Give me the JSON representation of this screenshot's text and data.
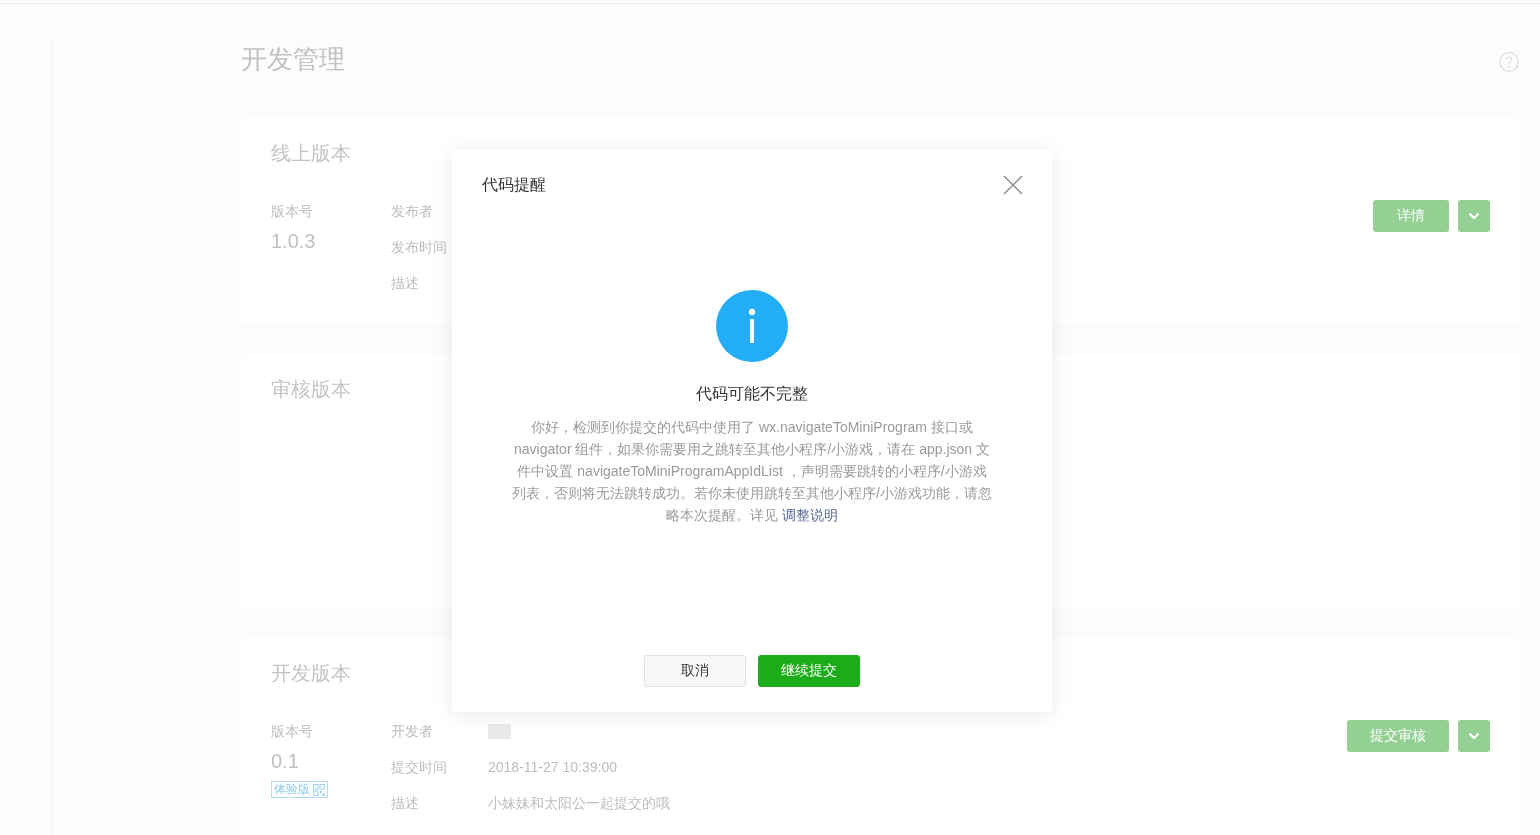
{
  "page": {
    "title": "开发管理"
  },
  "sections": [
    {
      "title": "线上版本",
      "version_label": "版本号",
      "version": "1.0.3",
      "fields": [
        {
          "label": "发布者",
          "blurred": false
        },
        {
          "label": "发布时间",
          "blurred": false
        },
        {
          "label": "描述",
          "blurred": false
        }
      ],
      "actions": [
        {
          "kind": "button",
          "label": "详情"
        },
        {
          "kind": "dropdown"
        }
      ]
    },
    {
      "title": "审核版本"
    },
    {
      "title": "开发版本",
      "version_label": "版本号",
      "version": "0.1",
      "tag": "体验版",
      "fields": [
        {
          "label": "开发者",
          "blurred": true
        },
        {
          "label": "提交时间",
          "blurred": false,
          "value": "2018-11-27 10:39:00"
        },
        {
          "label": "描述",
          "blurred": false,
          "value": "小妹妹和太阳公一起提交的哦"
        }
      ],
      "actions": [
        {
          "kind": "button",
          "label": "提交审核"
        },
        {
          "kind": "dropdown"
        }
      ]
    }
  ],
  "dialog": {
    "title": "代码提醒",
    "heading": "代码可能不完整",
    "message": "你好，检测到你提交的代码中使用了 wx.navigateToMiniProgram 接口或 navigator 组件，如果你需要用之跳转至其他小程序/小游戏，请在 app.json 文件中设置 navigateToMiniProgramAppIdList ，声明需要跳转的小程序/小游戏列表，否则将无法跳转成功。若你未使用跳转至其他小程序/小游戏功能，请忽略本次提醒。详见",
    "link": "调整说明",
    "buttons": [
      {
        "kind": "secondary",
        "label": "取消"
      },
      {
        "kind": "primary",
        "label": "继续提交"
      }
    ]
  }
}
